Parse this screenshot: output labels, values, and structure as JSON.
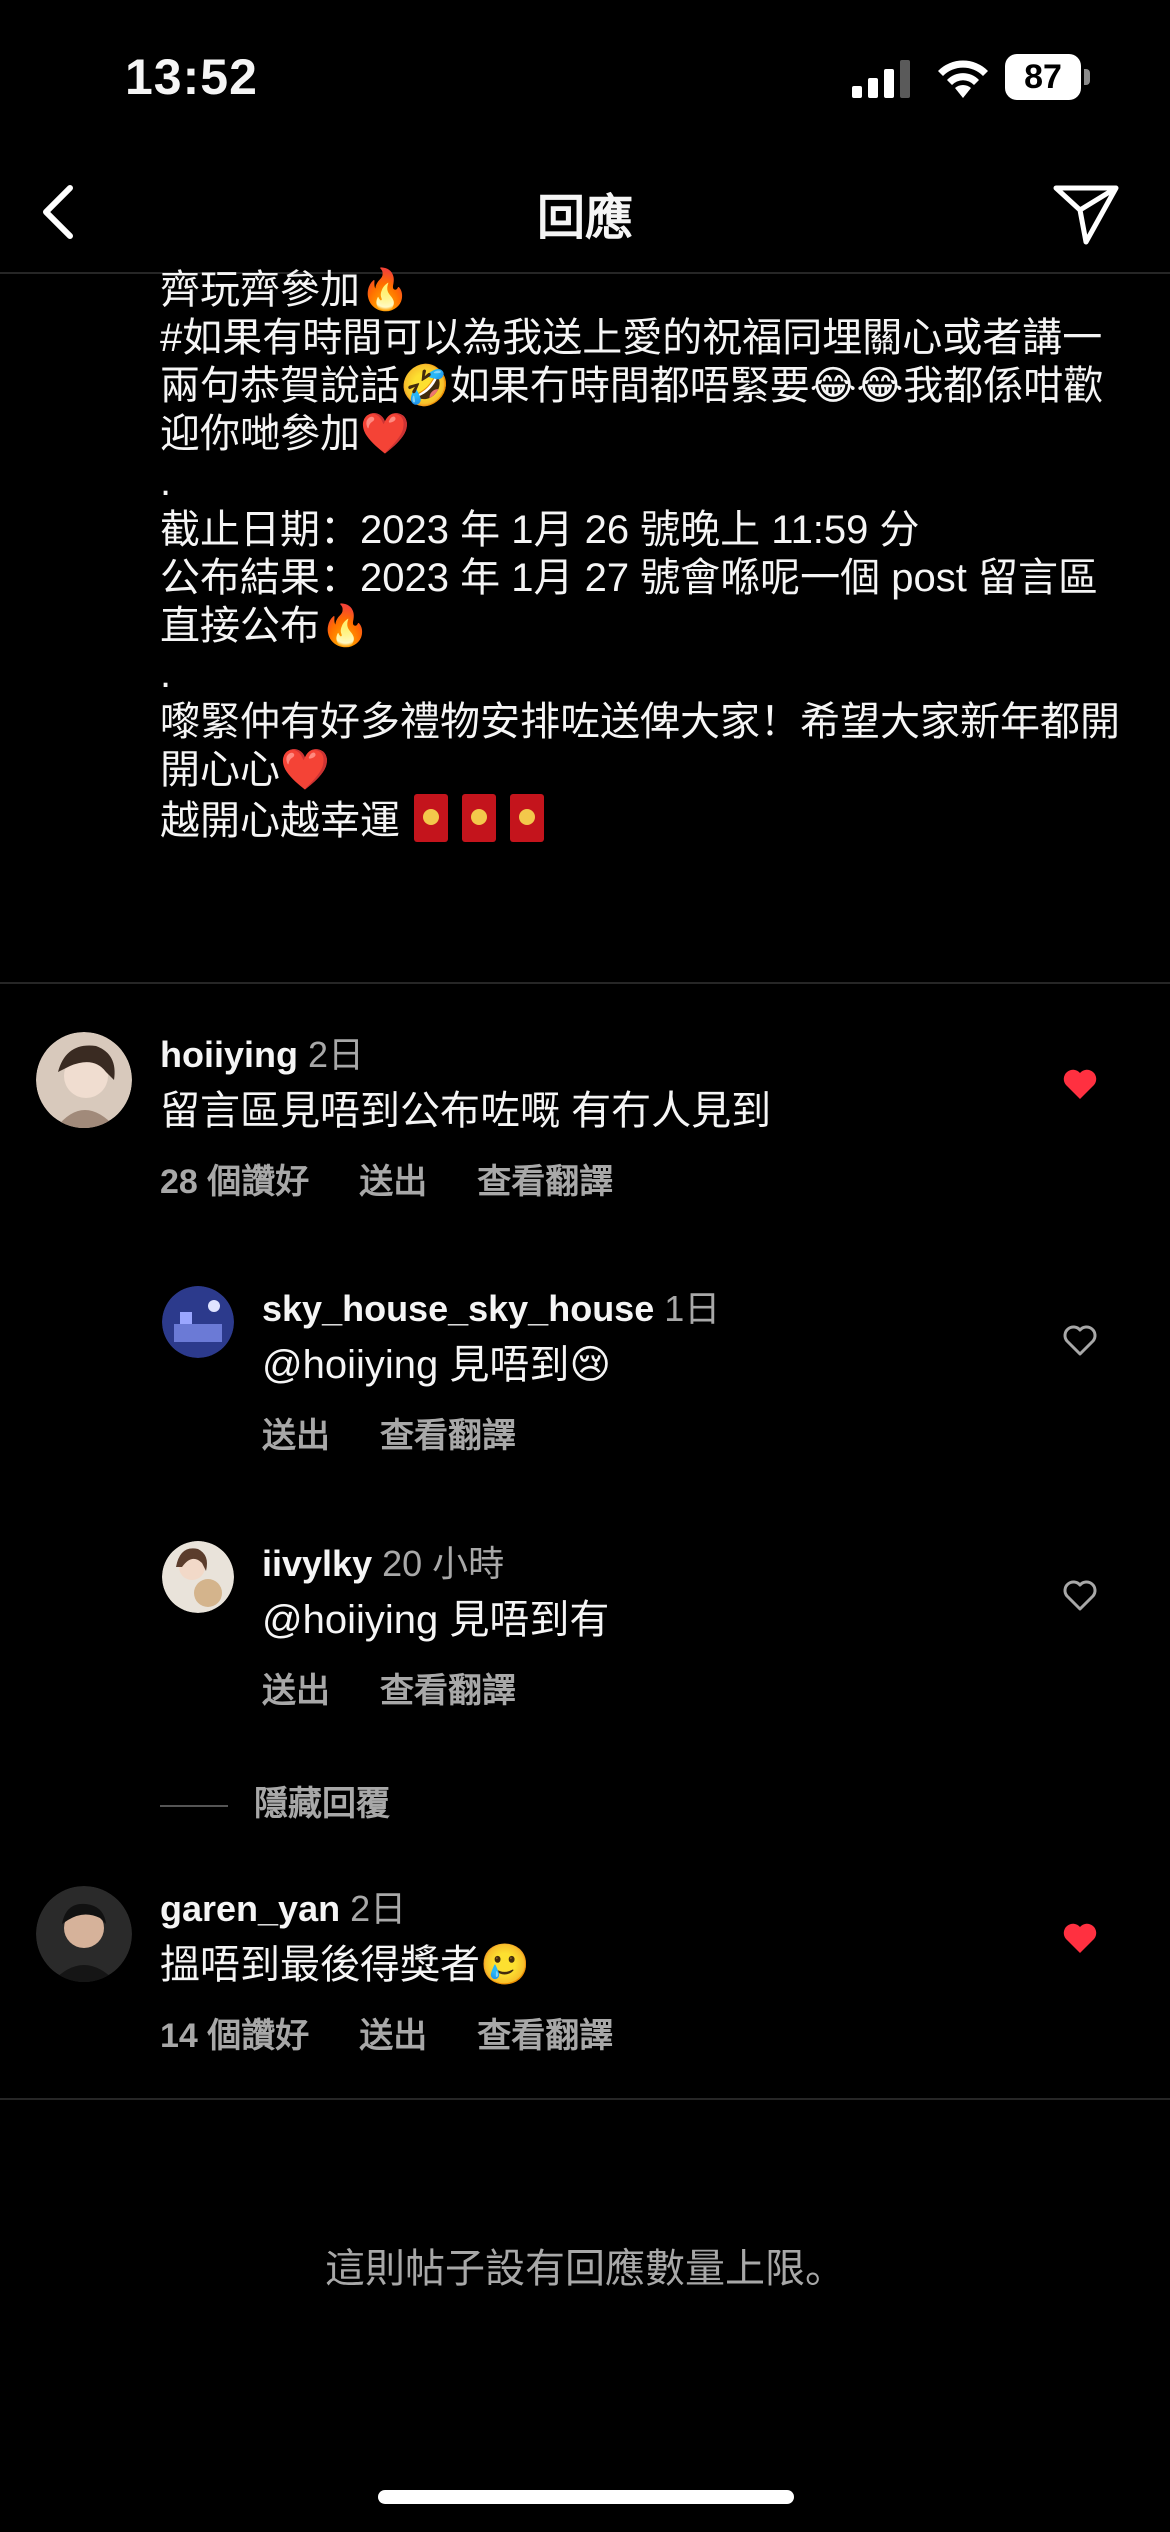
{
  "status_bar": {
    "time": "13:52",
    "battery": "87",
    "icons": [
      "cellular-signal-icon",
      "wifi-icon",
      "battery-icon"
    ]
  },
  "nav": {
    "title": "回應",
    "back_icon": "chevron-left-icon",
    "share_icon": "paper-plane-icon"
  },
  "caption": {
    "lines": [
      "齊玩齊參加🔥",
      "#如果有時間可以為我送上愛的祝福同埋關心或者講一兩句恭賀說話🤣如果冇時間都唔緊要😂😂我都係咁歡迎你哋參加❤️",
      ".",
      "截止日期：2023 年 1月 26 號晚上 11:59 分",
      "公布結果：2023 年 1月 27 號會喺呢一個 post 留言區直接公布🔥",
      ".",
      "嚟緊仲有好多禮物安排咗送俾大家！希望大家新年都開開心心❤️",
      "越開心越幸運"
    ],
    "red_packet_icon": "red-packet-icon"
  },
  "comments": [
    {
      "username": "hoiiying",
      "time": "2日",
      "text": "留言區見唔到公布咗嘅 有冇人見到",
      "likes": "28 個讚好",
      "reply": "送出",
      "translate": "查看翻譯",
      "liked": true
    },
    {
      "username": "garen_yan",
      "time": "2日",
      "text": "搵唔到最後得獎者🥲",
      "likes": "14 個讚好",
      "reply": "送出",
      "translate": "查看翻譯",
      "liked": true
    }
  ],
  "replies": [
    {
      "username": "sky_house_sky_house",
      "time": "1日",
      "text": "@hoiiying 見唔到😢",
      "reply": "送出",
      "translate": "查看翻譯",
      "liked": false
    },
    {
      "username": "iivylky",
      "time": "20 小時",
      "text": "@hoiiying 見唔到有",
      "reply": "送出",
      "translate": "查看翻譯",
      "liked": false
    }
  ],
  "hide_replies": "隱藏回覆",
  "limit_notice": "這則帖子設有回應數量上限。",
  "colors": {
    "background": "#000000",
    "text_primary": "#f5f5f5",
    "text_secondary": "#a8a8a8",
    "heart_red": "#ff3040",
    "divider": "#262626"
  }
}
